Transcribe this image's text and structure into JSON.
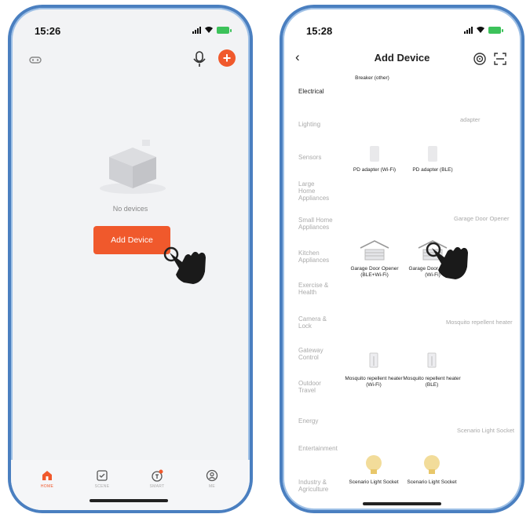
{
  "left_phone": {
    "time": "15:26",
    "empty_text": "No devices",
    "add_button": "Add Device",
    "tabs": [
      {
        "label": "HOME",
        "icon": "home-icon",
        "active": true
      },
      {
        "label": "SCENE",
        "icon": "scene-icon",
        "active": false
      },
      {
        "label": "SMART",
        "icon": "smart-icon",
        "active": false
      },
      {
        "label": "ME",
        "icon": "profile-icon",
        "active": false
      }
    ]
  },
  "right_phone": {
    "time": "15:28",
    "title": "Add Device",
    "categories": [
      "Electrical",
      "Lighting",
      "Sensors",
      "Large Home Appliances",
      "Small Home Appliances",
      "Kitchen Appliances",
      "Exercise & Health",
      "Camera & Lock",
      "Gateway Control",
      "Outdoor Travel",
      "Energy",
      "Entertainment",
      "Industry & Agriculture"
    ],
    "active_category": "Electrical",
    "items": {
      "breaker": "Breaker (other)",
      "section_adapter": "adapter",
      "pd_wifi": "PD adapter (Wi-Fi)",
      "pd_ble": "PD adapter (BLE)",
      "section_garage": "Garage Door Opener",
      "garage_ble_wifi": "Garage Door Opener (BLE+Wi-Fi)",
      "garage_wifi": "Garage Door Opener (Wi-Fi)",
      "section_mosquito": "Mosquito repellent heater",
      "mosquito_wifi": "Mosquito repellent heater (Wi-Fi)",
      "mosquito_ble": "Mosquito repellent heater (BLE)",
      "section_scenario": "Scenario Light Socket",
      "scenario1": "Scenario Light Socket",
      "scenario2": "Scenario Light Socket"
    }
  },
  "colors": {
    "accent": "#f0592c",
    "frame": "#4a7fc0"
  }
}
